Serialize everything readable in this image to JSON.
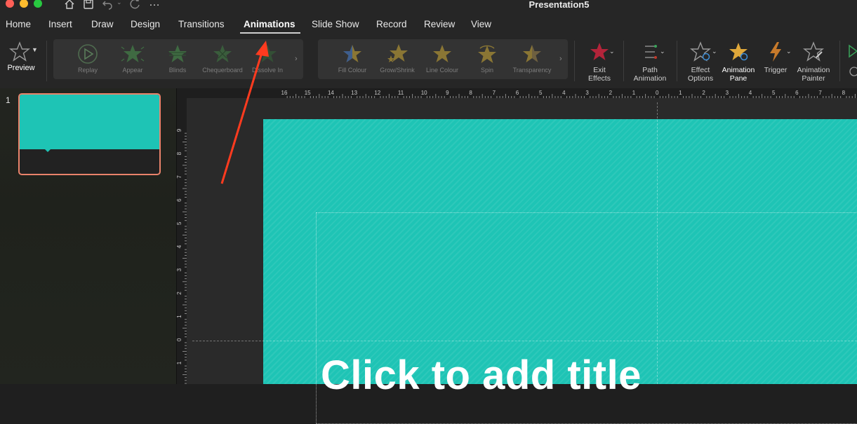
{
  "window": {
    "title": "Presentation5",
    "traffic_colors": {
      "close": "#ff5f57",
      "minimize": "#febc2e",
      "zoom": "#28c840"
    },
    "toolbar_icons": [
      "home-icon",
      "save-icon",
      "undo-icon",
      "redo-icon",
      "more-icon"
    ],
    "more_glyph": "…"
  },
  "tabs": [
    {
      "label": "Home"
    },
    {
      "label": "Insert"
    },
    {
      "label": "Draw"
    },
    {
      "label": "Design"
    },
    {
      "label": "Transitions"
    },
    {
      "label": "Animations",
      "active": true
    },
    {
      "label": "Slide Show"
    },
    {
      "label": "Record"
    },
    {
      "label": "Review"
    },
    {
      "label": "View"
    }
  ],
  "ribbon": {
    "preview": {
      "label": "Preview"
    },
    "entrance_gallery": [
      {
        "label": "Replay",
        "icon": "replay-icon"
      },
      {
        "label": "Appear",
        "icon": "star-icon"
      },
      {
        "label": "Blinds",
        "icon": "star-icon"
      },
      {
        "label": "Chequerboard",
        "icon": "star-icon"
      },
      {
        "label": "Dissolve In",
        "icon": "star-icon"
      }
    ],
    "emphasis_gallery": [
      {
        "label": "Fill Colour",
        "icon": "star-icon"
      },
      {
        "label": "Grow/Shrink",
        "icon": "star-icon"
      },
      {
        "label": "Line Colour",
        "icon": "star-icon"
      },
      {
        "label": "Spin",
        "icon": "star-icon"
      },
      {
        "label": "Transparency",
        "icon": "star-icon"
      }
    ],
    "gallery_scroll_glyph": "›",
    "exit_effects": {
      "line1": "Exit",
      "line2": "Effects"
    },
    "path_animation": {
      "line1": "Path",
      "line2": "Animation"
    },
    "effect_options": {
      "line1": "Effect",
      "line2": "Options"
    },
    "animation_pane": {
      "line1": "Animation",
      "line2": "Pane"
    },
    "trigger": {
      "label": "Trigger"
    },
    "animation_painter": {
      "line1": "Animation",
      "line2": "Painter"
    }
  },
  "colors": {
    "accent_teal": "#1ec4b5",
    "thumb_border": "#e9836b",
    "annotation_arrow": "#ff3b1f",
    "exit_star": "#c0283a",
    "emphasis_star": "#c9a227"
  },
  "thumbnails": [
    {
      "number": "1"
    }
  ],
  "ruler": {
    "h_labels": [
      "16",
      "15",
      "14",
      "13",
      "12",
      "11",
      "10",
      "9",
      "8",
      "7",
      "6",
      "5",
      "4",
      "3",
      "2",
      "1",
      "0",
      "1",
      "2",
      "3",
      "4",
      "5",
      "6",
      "7",
      "8"
    ],
    "v_labels": [
      "9",
      "8",
      "7",
      "6",
      "5",
      "4",
      "3",
      "2",
      "1",
      "0",
      "1"
    ]
  },
  "slide": {
    "title_placeholder": "Click to add title"
  }
}
